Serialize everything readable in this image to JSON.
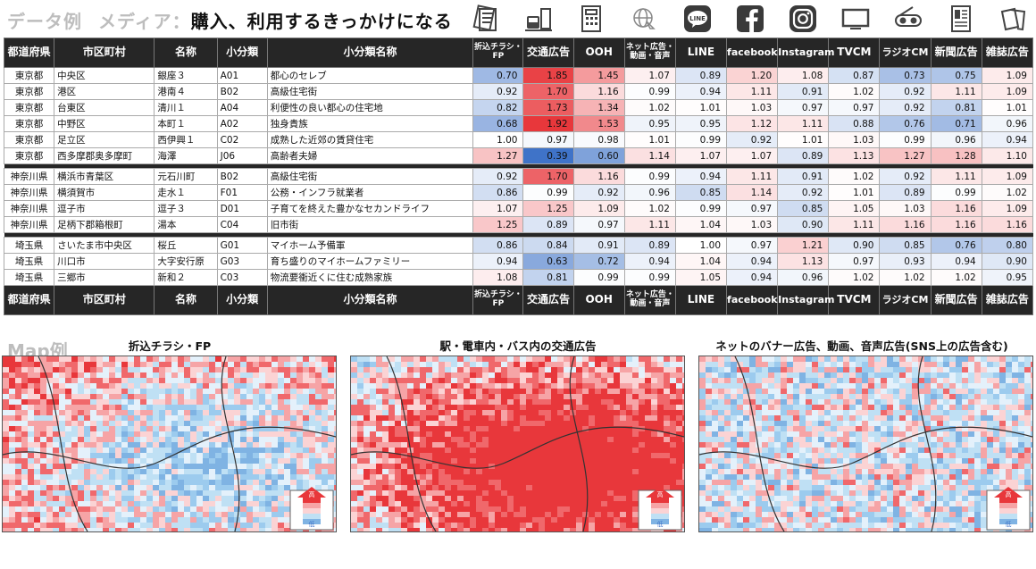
{
  "header": {
    "title1": "データ例",
    "title2": "メディア：",
    "subtitle": "購入、利用するきっかけになる"
  },
  "icons": [
    "flyer-icon",
    "transit-icon",
    "building-icon",
    "web-globe-icon",
    "line-icon",
    "facebook-icon",
    "instagram-icon",
    "tv-icon",
    "radio-icon",
    "newspaper-icon",
    "magazine-icon"
  ],
  "colors": {
    "high": "#e8373b",
    "low": "#3f73c8",
    "header_bg": "#262626"
  },
  "table": {
    "columns": [
      "都道府県",
      "市区町村",
      "名称",
      "小分類",
      "小分類名称",
      "折込チラシ・FP",
      "交通広告",
      "OOH",
      "ネット広告・動画・音声",
      "LINE",
      "facebook",
      "Instagram",
      "TVCM",
      "ラジオCM",
      "新聞広告",
      "雑誌広告"
    ],
    "groups": [
      [
        [
          "東京都",
          "中央区",
          "銀座３",
          "A01",
          "都心のセレブ",
          "0.70",
          "1.85",
          "1.45",
          "1.07",
          "0.89",
          "1.20",
          "1.08",
          "0.87",
          "0.73",
          "0.75",
          "1.09"
        ],
        [
          "東京都",
          "港区",
          "港南４",
          "B02",
          "高級住宅街",
          "0.92",
          "1.70",
          "1.16",
          "0.99",
          "0.94",
          "1.11",
          "0.91",
          "1.02",
          "0.92",
          "1.11",
          "1.09"
        ],
        [
          "東京都",
          "台東区",
          "清川１",
          "A04",
          "利便性の良い都心の住宅地",
          "0.82",
          "1.73",
          "1.34",
          "1.02",
          "1.01",
          "1.03",
          "0.97",
          "0.97",
          "0.92",
          "0.81",
          "1.01"
        ],
        [
          "東京都",
          "中野区",
          "本町１",
          "A02",
          "独身貴族",
          "0.68",
          "1.92",
          "1.53",
          "0.95",
          "0.95",
          "1.12",
          "1.11",
          "0.88",
          "0.76",
          "0.71",
          "0.96"
        ],
        [
          "東京都",
          "足立区",
          "西伊興１",
          "C02",
          "成熟した近郊の賃貸住宅",
          "1.00",
          "0.97",
          "0.98",
          "1.01",
          "0.99",
          "0.92",
          "1.01",
          "1.03",
          "0.99",
          "0.96",
          "0.94"
        ],
        [
          "東京都",
          "西多摩郡奥多摩町",
          "海澤",
          "J06",
          "高齢者夫婦",
          "1.27",
          "0.39",
          "0.60",
          "1.14",
          "1.07",
          "1.07",
          "0.89",
          "1.13",
          "1.27",
          "1.28",
          "1.10"
        ]
      ],
      [
        [
          "神奈川県",
          "横浜市青葉区",
          "元石川町",
          "B02",
          "高級住宅街",
          "0.92",
          "1.70",
          "1.16",
          "0.99",
          "0.94",
          "1.11",
          "0.91",
          "1.02",
          "0.92",
          "1.11",
          "1.09"
        ],
        [
          "神奈川県",
          "横須賀市",
          "走水１",
          "F01",
          "公務・インフラ就業者",
          "0.86",
          "0.99",
          "0.92",
          "0.96",
          "0.85",
          "1.14",
          "0.92",
          "1.01",
          "0.89",
          "0.99",
          "1.02"
        ],
        [
          "神奈川県",
          "逗子市",
          "逗子３",
          "D01",
          "子育てを終えた豊かなセカンドライフ",
          "1.07",
          "1.25",
          "1.09",
          "1.02",
          "0.99",
          "0.97",
          "0.85",
          "1.05",
          "1.03",
          "1.16",
          "1.09"
        ],
        [
          "神奈川県",
          "足柄下郡箱根町",
          "湯本",
          "C04",
          "旧市街",
          "1.25",
          "0.89",
          "0.97",
          "1.11",
          "1.04",
          "1.03",
          "0.90",
          "1.11",
          "1.16",
          "1.16",
          "1.16"
        ]
      ],
      [
        [
          "埼玉県",
          "さいたま市中央区",
          "桜丘",
          "G01",
          "マイホーム予備軍",
          "0.86",
          "0.84",
          "0.91",
          "0.89",
          "1.00",
          "0.97",
          "1.21",
          "0.90",
          "0.85",
          "0.76",
          "0.80"
        ],
        [
          "埼玉県",
          "川口市",
          "大字安行原",
          "G03",
          "育ち盛りのマイホームファミリー",
          "0.94",
          "0.63",
          "0.72",
          "0.94",
          "1.04",
          "0.94",
          "1.13",
          "0.97",
          "0.93",
          "0.94",
          "0.90"
        ],
        [
          "埼玉県",
          "三郷市",
          "新和２",
          "C03",
          "物流要衝近くに住む成熟家族",
          "1.08",
          "0.81",
          "0.99",
          "0.99",
          "1.05",
          "0.94",
          "0.96",
          "1.02",
          "1.02",
          "1.02",
          "0.95"
        ]
      ]
    ]
  },
  "maps": {
    "label": "Map例",
    "items": [
      {
        "title": "折込チラシ・FP",
        "legend_high": "高",
        "legend_low": "低",
        "red_bias": 0.28
      },
      {
        "title": "駅・電車内・バス内の交通広告",
        "legend_high": "高",
        "legend_low": "低",
        "red_bias": 0.78
      },
      {
        "title": "ネットのバナー広告、動画、音声広告(SNS上の広告含む)",
        "legend_high": "高",
        "legend_low": "低",
        "red_bias": 0.5
      }
    ]
  }
}
